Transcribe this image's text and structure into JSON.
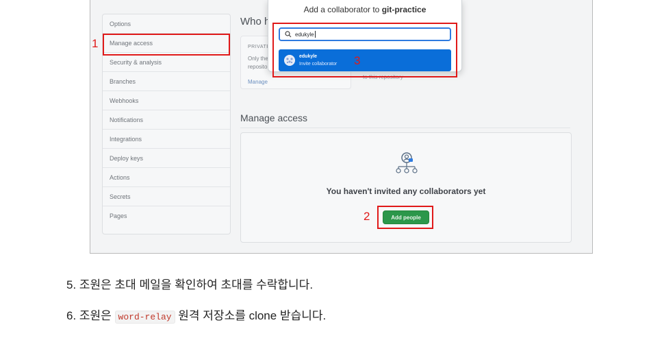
{
  "sidebar": {
    "items": [
      "Options",
      "Manage access",
      "Security & analysis",
      "Branches",
      "Webhooks",
      "Notifications",
      "Integrations",
      "Deploy keys",
      "Actions",
      "Secrets",
      "Pages"
    ]
  },
  "who_section": {
    "title": "Who h",
    "private_label": "PRIVATE",
    "private_desc": "Only the\nreposito",
    "manage_link": "Manage",
    "faded_text": "to this repository"
  },
  "manage_access": {
    "title": "Manage access",
    "empty_message": "You haven't invited any collaborators yet",
    "add_button": "Add people"
  },
  "modal": {
    "title_prefix": "Add a collaborator to ",
    "repo_name": "git-practice",
    "search_value": "edukyle",
    "suggestion_name": "edukyle",
    "suggestion_action": "Invite collaborator"
  },
  "annotations": [
    "1",
    "2",
    "3"
  ],
  "steps": {
    "step5": "5.  조원은 초대 메일을 확인하여 초대를 수락합니다.",
    "step6_prefix": "6.  조원은 ",
    "step6_code": "word-relay",
    "step6_suffix": " 원격 저장소를 clone 받습니다."
  },
  "colors": {
    "accent_red": "#e01919",
    "primary_blue": "#0a6ed9",
    "button_green": "#2c974b"
  },
  "icons": [
    "search-icon",
    "people-icon",
    "user-avatar-icon"
  ]
}
